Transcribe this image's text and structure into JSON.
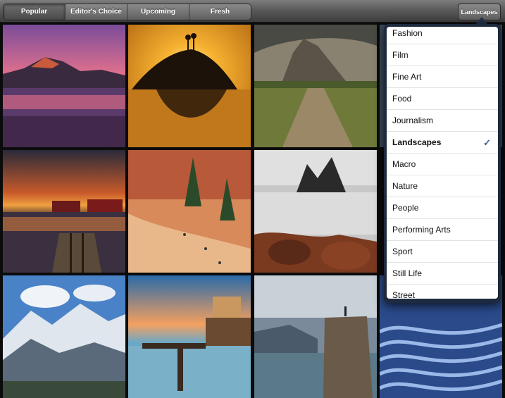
{
  "toolbar": {
    "tabs": [
      {
        "label": "Popular"
      },
      {
        "label": "Editor's Choice"
      },
      {
        "label": "Upcoming"
      },
      {
        "label": "Fresh"
      }
    ],
    "category_button_label": "Landscapes"
  },
  "categories_menu": {
    "items": [
      {
        "label": "Fashion"
      },
      {
        "label": "Film"
      },
      {
        "label": "Fine Art"
      },
      {
        "label": "Food"
      },
      {
        "label": "Journalism"
      },
      {
        "label": "Landscapes",
        "selected": true
      },
      {
        "label": "Macro"
      },
      {
        "label": "Nature"
      },
      {
        "label": "People"
      },
      {
        "label": "Performing Arts"
      },
      {
        "label": "Sport"
      },
      {
        "label": "Still Life"
      },
      {
        "label": "Street"
      }
    ],
    "check_glyph": "✓"
  },
  "photos": [
    {
      "subject": "pink sunset mountain over lake"
    },
    {
      "subject": "golden sunset rock island with trees"
    },
    {
      "subject": "dirt road toward rocky mountain"
    },
    {
      "subject": "partially visible photo"
    },
    {
      "subject": "sunset over harbor with pier"
    },
    {
      "subject": "red canyon with trees and hikers"
    },
    {
      "subject": "sea stacks with long exposure water"
    },
    {
      "subject": "snowy mountain range under clouds"
    },
    {
      "subject": "ocean pool with building at sunrise"
    },
    {
      "subject": "cliff overlooking fjord"
    },
    {
      "subject": "blue terraced rice fields"
    }
  ]
}
